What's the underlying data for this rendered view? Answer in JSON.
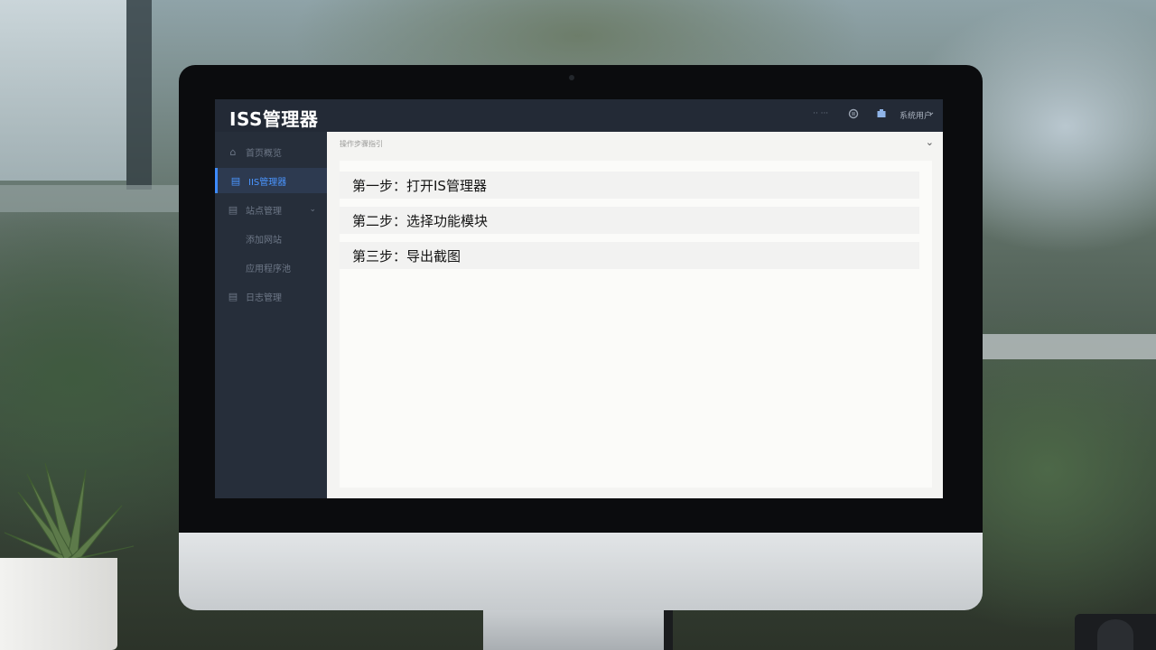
{
  "app": {
    "brand": "ISS管理器"
  },
  "topbar": {
    "label": "·· ···",
    "user": "系统用户"
  },
  "sidebar": {
    "items": [
      {
        "label": "首页概览"
      },
      {
        "label": "IIS管理器"
      },
      {
        "label": "站点管理"
      },
      {
        "label": "添加网站"
      },
      {
        "label": "应用程序池"
      },
      {
        "label": "日志管理"
      }
    ]
  },
  "content": {
    "breadcrumb": "操作步骤指引",
    "steps": [
      {
        "label": "第一步：打开IS管理器"
      },
      {
        "label": "第二步：选择功能模块"
      },
      {
        "label": "第三步：导出截图"
      }
    ]
  },
  "colors": {
    "accent": "#3d8bfd",
    "sidebar_bg": "#262e3a",
    "topbar_bg": "#232a36",
    "content_bg": "#f4f4f2"
  },
  "icons": {
    "home": "home-icon",
    "iis": "document-icon",
    "site": "folder-icon",
    "log": "log-icon",
    "message": "message-icon",
    "notification": "notification-icon",
    "chevron": "chevron-down-icon"
  }
}
